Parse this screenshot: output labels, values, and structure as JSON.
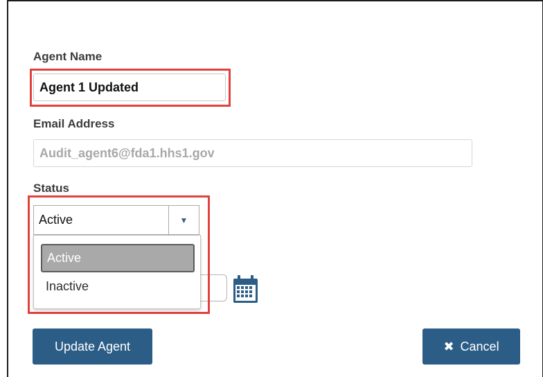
{
  "form": {
    "agent_name_label": "Agent Name",
    "agent_name_value": "Agent 1 Updated",
    "email_label": "Email Address",
    "email_value": "Audit_agent6@fda1.hhs1.gov",
    "status_label": "Status",
    "status_selected": "Active",
    "status_options": [
      "Active",
      "Inactive"
    ]
  },
  "icons": {
    "dropdown_arrow": "caret-down-icon",
    "date": "calendar-icon",
    "cancel": "close-icon"
  },
  "buttons": {
    "update_label": "Update Agent",
    "cancel_label": "Cancel",
    "cancel_glyph": "✖"
  },
  "colors": {
    "highlight": "#e0413d",
    "button_primary": "#2c5d86",
    "calendar_icon": "#2c5d86"
  }
}
